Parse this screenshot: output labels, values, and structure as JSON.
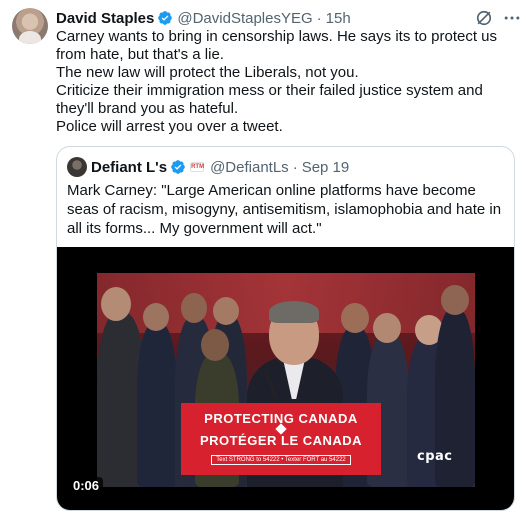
{
  "author": {
    "name": "David Staples",
    "handle": "@DavidStaplesYEG",
    "separator": "·",
    "time": "15h"
  },
  "tweet": {
    "lines": [
      "Carney wants to bring in censorship laws. He says its to protect us from hate, but that's a lie.",
      "The new law will protect the Liberals, not you.",
      "Criticize their immigration mess or their failed justice system and they'll brand you as hateful.",
      "Police will arrest you over a tweet."
    ]
  },
  "quote": {
    "name": "Defiant L's",
    "affiliate_badge": "RTM",
    "handle": "@DefiantLs",
    "separator": "·",
    "time": "Sep 19",
    "text": "Mark Carney: \"Large American online platforms have become seas of racism, misogyny, antisemitism, islamophobia and hate in all its forms... My government will act.\""
  },
  "video": {
    "podium_line1": "PROTECTING CANADA",
    "podium_line2": "PROTÉGER LE CANADA",
    "podium_strip": "Text STRONG to 54222 • Texter FORT au 54222",
    "broadcaster": "cpac",
    "duration": "0:06"
  },
  "colors": {
    "text": "#0f1419",
    "secondary": "#536471",
    "verified": "#1d9bf0",
    "border": "#cfd9de",
    "podium": "#d8212f"
  },
  "icons": {
    "verified": "verified-badge-icon",
    "grok": "grok-icon",
    "more": "more-options-icon"
  }
}
